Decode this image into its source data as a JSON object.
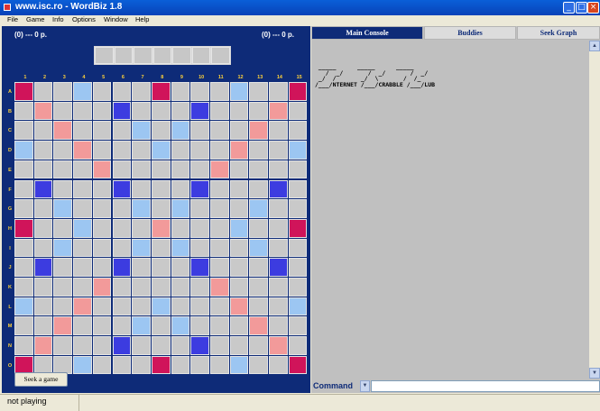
{
  "window": {
    "title": "www.isc.ro - WordBiz 1.8"
  },
  "menu": [
    "File",
    "Game",
    "Info",
    "Options",
    "Window",
    "Help"
  ],
  "scores": {
    "left": "(0) ---      0 p.",
    "right": "(0) ---      0 p."
  },
  "board": {
    "columns": [
      "1",
      "2",
      "3",
      "4",
      "5",
      "6",
      "7",
      "8",
      "9",
      "10",
      "11",
      "12",
      "13",
      "14",
      "15"
    ],
    "rows": [
      "A",
      "B",
      "C",
      "D",
      "E",
      "F",
      "G",
      "H",
      "I",
      "J",
      "K",
      "L",
      "M",
      "N",
      "O"
    ]
  },
  "seek_button": "Seek a game",
  "tabs": [
    "Main Console",
    "Buddies",
    "Seek Graph"
  ],
  "console_banner": " _____      _____      _____\n   /  _/       /  _/       /  _/\n _/  /       _/  \\       /  /_\n/___/NTERNET /___/CRABBLE /___/LUB",
  "command_label": "Command",
  "status": "not playing",
  "colors": {
    "panel": "#0e2b78",
    "tw": "#d0145a",
    "dw": "#f29a9a",
    "tl": "#3c3ce0",
    "dl": "#9cc6f2"
  }
}
